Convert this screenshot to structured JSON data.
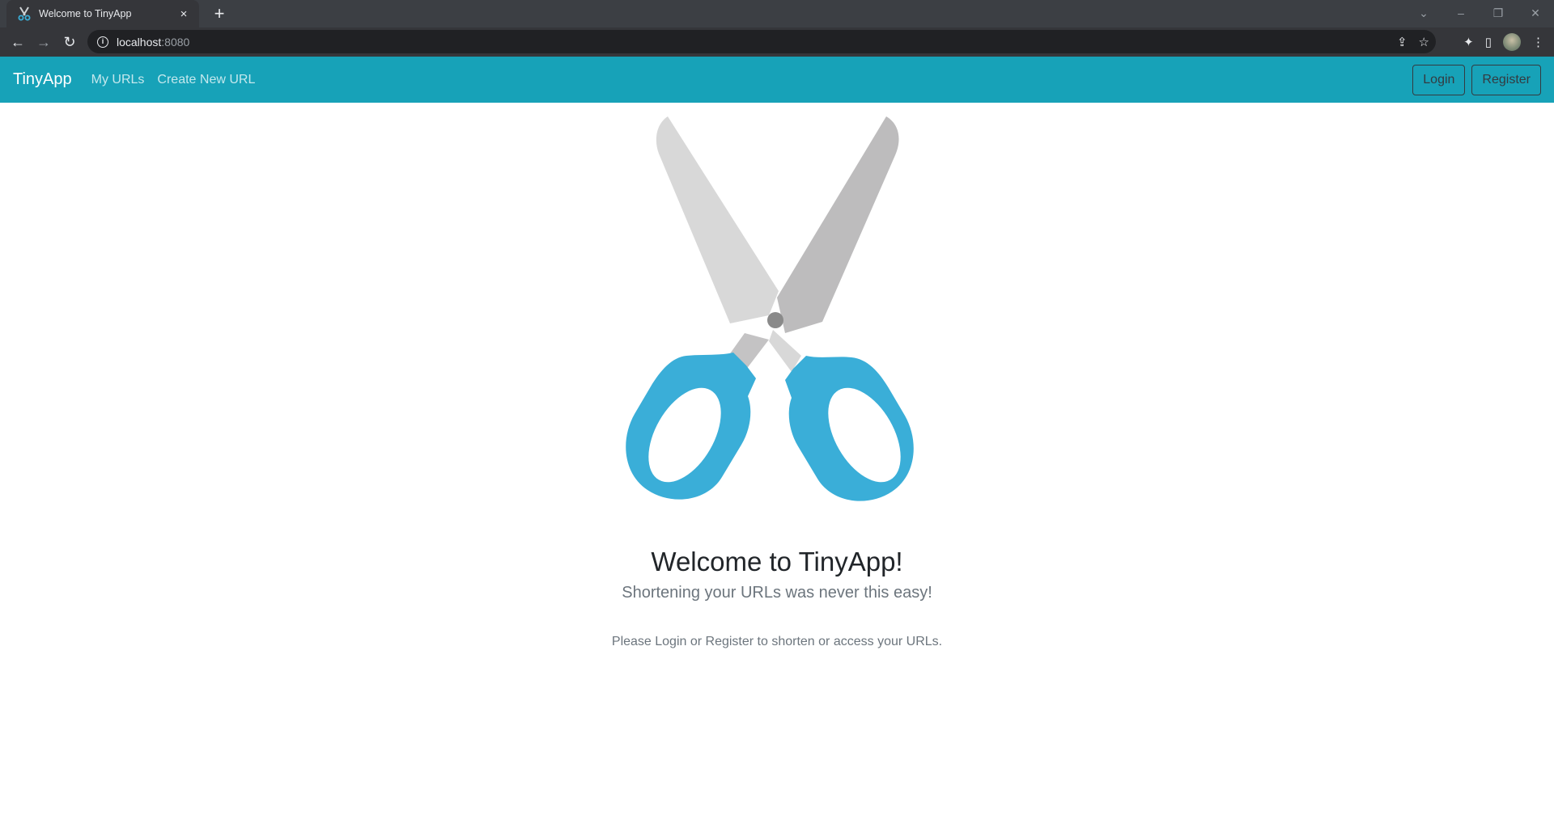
{
  "browser": {
    "tab_title": "Welcome to TinyApp",
    "close_glyph": "×",
    "new_tab_glyph": "+",
    "url_host": "localhost",
    "url_port": ":8080"
  },
  "navbar": {
    "brand": "TinyApp",
    "links": [
      "My URLs",
      "Create New URL"
    ],
    "login_label": "Login",
    "register_label": "Register",
    "color": "#17a2b8"
  },
  "main": {
    "title": "Welcome to TinyApp!",
    "subtitle": "Shortening your URLs was never this easy!",
    "note": "Please Login or Register to shorten or access your URLs."
  },
  "icons": [
    "scissors-icon",
    "back-icon",
    "forward-icon",
    "reload-icon",
    "info-icon",
    "share-icon",
    "star-icon",
    "extensions-icon",
    "side-panel-icon",
    "menu-icon"
  ],
  "colors": {
    "handle": "#3aaed8",
    "blade_light": "#d8d8d8",
    "blade_dark": "#bdbcbd",
    "pivot": "#8a8a8a"
  }
}
